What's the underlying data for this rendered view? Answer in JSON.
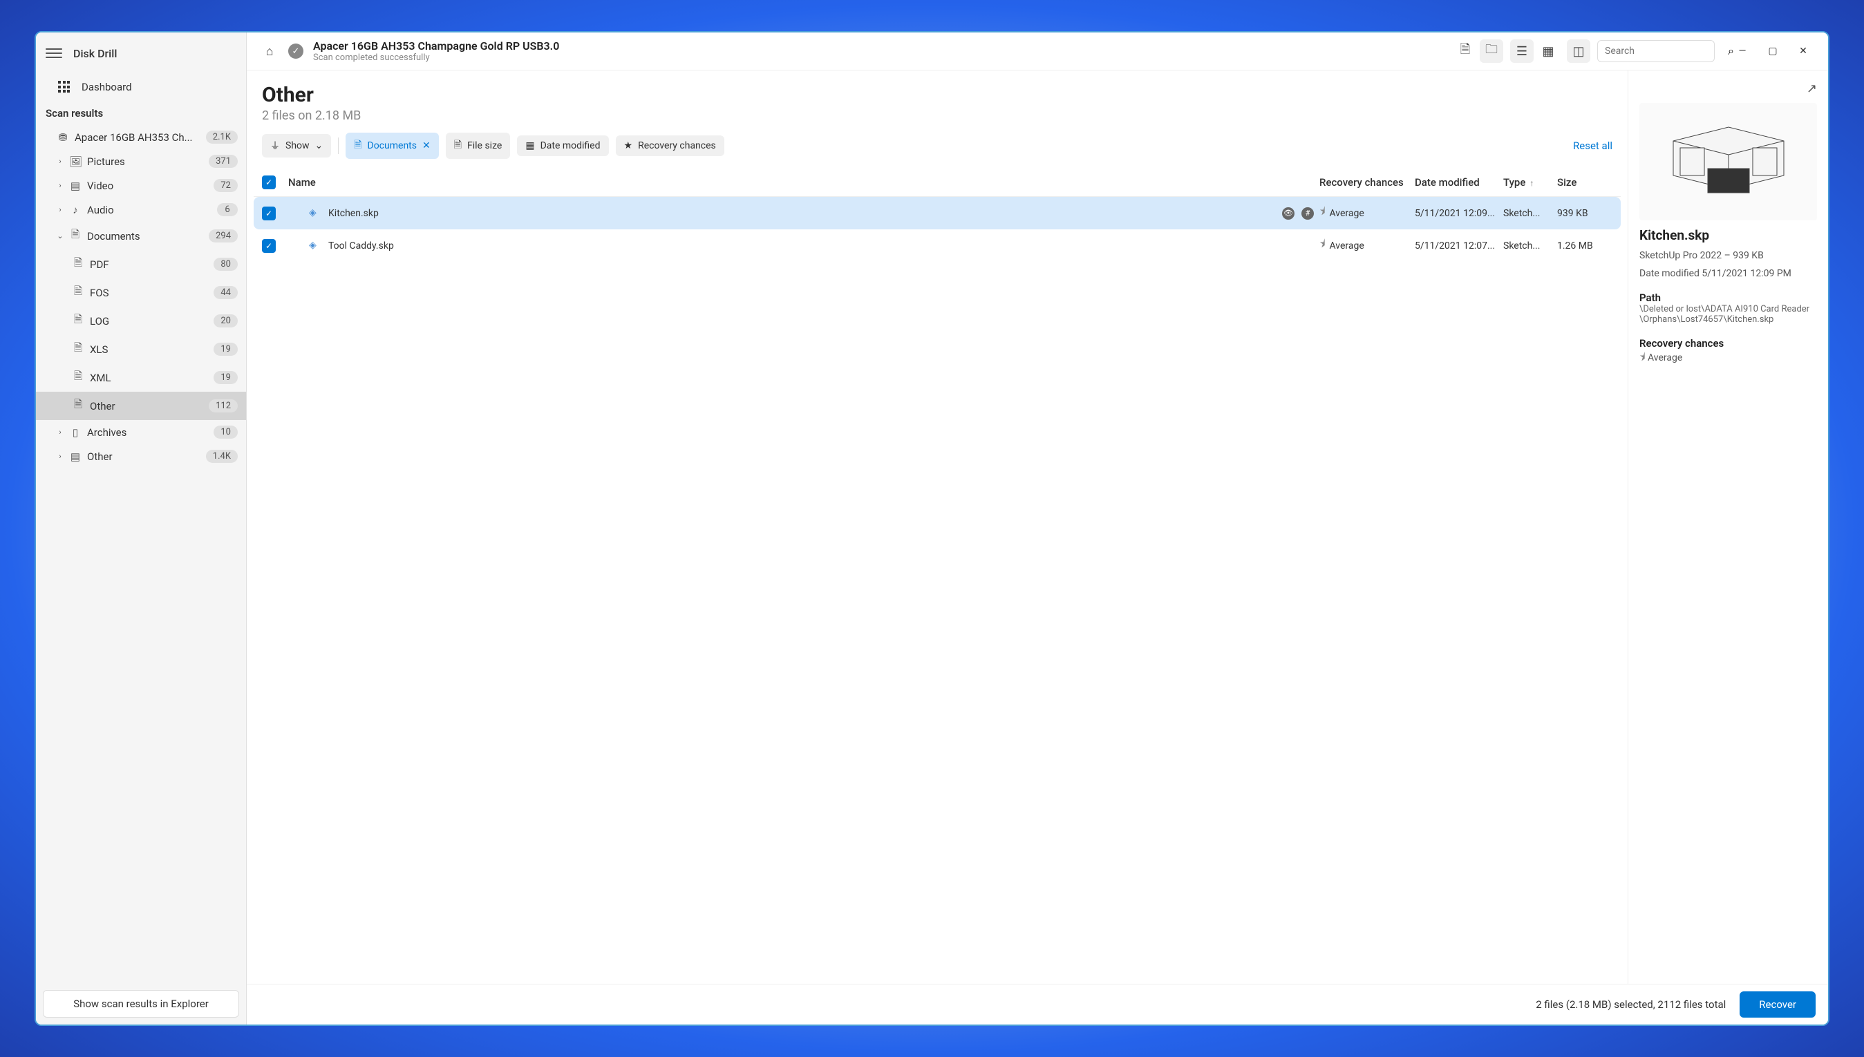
{
  "app_title": "Disk Drill",
  "dashboard_label": "Dashboard",
  "section_label": "Scan results",
  "sidebar_items": [
    {
      "label": "Apacer 16GB AH353 Ch...",
      "badge": "2.1K"
    },
    {
      "label": "Pictures",
      "badge": "371"
    },
    {
      "label": "Video",
      "badge": "72"
    },
    {
      "label": "Audio",
      "badge": "6"
    },
    {
      "label": "Documents",
      "badge": "294"
    },
    {
      "label": "PDF",
      "badge": "80"
    },
    {
      "label": "FOS",
      "badge": "44"
    },
    {
      "label": "LOG",
      "badge": "20"
    },
    {
      "label": "XLS",
      "badge": "19"
    },
    {
      "label": "XML",
      "badge": "19"
    },
    {
      "label": "Other",
      "badge": "112"
    },
    {
      "label": "Archives",
      "badge": "10"
    },
    {
      "label": "Other",
      "badge": "1.4K"
    }
  ],
  "explorer_btn": "Show scan results in Explorer",
  "topbar": {
    "title": "Apacer 16GB AH353 Champagne Gold RP USB3.0",
    "subtitle": "Scan completed successfully",
    "search_placeholder": "Search"
  },
  "page": {
    "title": "Other",
    "subtitle": "2 files on 2.18 MB"
  },
  "filters": {
    "show": "Show",
    "documents": "Documents",
    "file_size": "File size",
    "date_modified": "Date modified",
    "recovery": "Recovery chances",
    "reset": "Reset all"
  },
  "columns": {
    "name": "Name",
    "recovery": "Recovery chances",
    "date": "Date modified",
    "type": "Type",
    "size": "Size"
  },
  "rows": [
    {
      "name": "Kitchen.skp",
      "recovery": "Average",
      "date": "5/11/2021 12:09...",
      "type": "Sketch...",
      "size": "939 KB",
      "selected": true
    },
    {
      "name": "Tool Caddy.skp",
      "recovery": "Average",
      "date": "5/11/2021 12:07...",
      "type": "Sketch...",
      "size": "1.26 MB",
      "selected": false
    }
  ],
  "preview": {
    "title": "Kitchen.skp",
    "meta": "SketchUp Pro 2022 – 939 KB",
    "date": "Date modified 5/11/2021 12:09 PM",
    "path_label": "Path",
    "path": "\\Deleted or lost\\ADATA AI910 Card Reader\\Orphans\\Lost74657\\Kitchen.skp",
    "rec_label": "Recovery chances",
    "rec_value": "Average"
  },
  "status": {
    "text": "2 files (2.18 MB) selected, 2112 files total",
    "recover": "Recover"
  }
}
